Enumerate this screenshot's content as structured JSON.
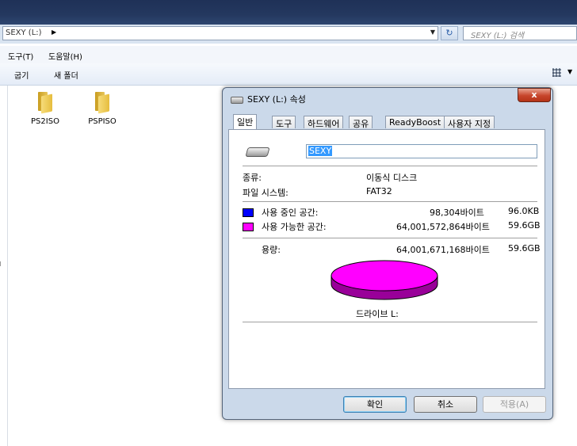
{
  "explorer": {
    "address": "SEXY (L:)",
    "search_placeholder": "SEXY (L:) 검색",
    "menu": [
      "도구(T)",
      "도움말(H)"
    ],
    "toolbar": [
      "굽기",
      "새 폴더"
    ],
    "folders": [
      {
        "name": "PS2ISO",
        "icon": "folder-icon"
      },
      {
        "name": "PSPISO",
        "icon": "folder-icon"
      }
    ]
  },
  "dialog": {
    "title": "SEXY (L:) 속성",
    "close_glyph": "x",
    "tabs": [
      "일반",
      "도구",
      "하드웨어",
      "공유",
      "ReadyBoost",
      "사용자 지정"
    ],
    "active_tab": "일반",
    "volume_name": "SEXY",
    "type_label": "종류:",
    "type_value": "이동식 디스크",
    "fs_label": "파일 시스템:",
    "fs_value": "FAT32",
    "used": {
      "label": "사용 중인 공간:",
      "bytes": "98,304바이트",
      "size": "96.0KB",
      "color": "#0000ff"
    },
    "free": {
      "label": "사용 가능한 공간:",
      "bytes": "64,001,572,864바이트",
      "size": "59.6GB",
      "color": "#ff00ff"
    },
    "capacity": {
      "label": "용량:",
      "bytes": "64,001,671,168바이트",
      "size": "59.6GB"
    },
    "drive_caption": "드라이브 L:",
    "buttons": {
      "ok": "확인",
      "cancel": "취소",
      "apply": "적용(A)"
    }
  }
}
